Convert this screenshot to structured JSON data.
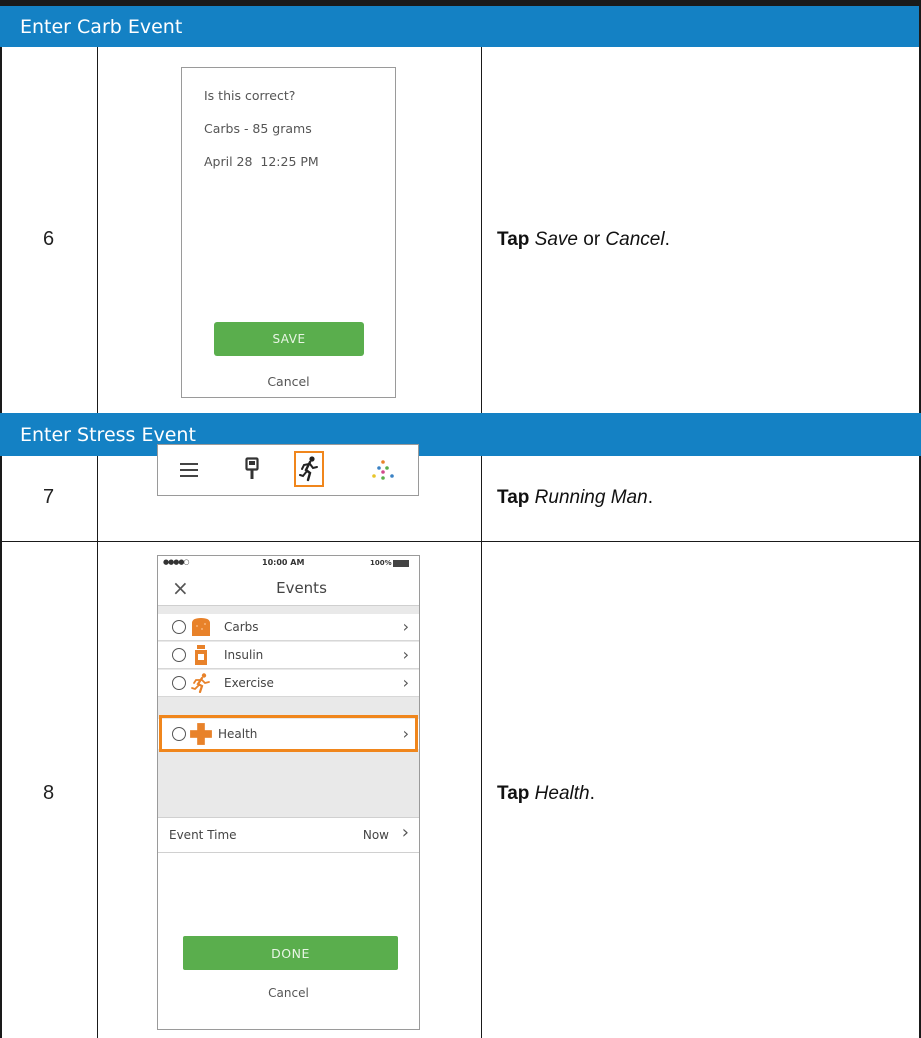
{
  "sections": {
    "carb_title": "Enter Carb Event",
    "stress_title": "Enter Stress Event"
  },
  "steps": [
    {
      "number": "6",
      "action": "Tap",
      "target": "Save",
      "connector": " or ",
      "target2": "Cancel",
      "end": "."
    },
    {
      "number": "7",
      "action": "Tap",
      "target": "Running Man",
      "end": "."
    },
    {
      "number": "8",
      "action": "Tap",
      "target": "Health",
      "end": "."
    }
  ],
  "confirm_screen": {
    "question": "Is this correct?",
    "carbs_line": "Carbs - 85 grams",
    "datetime": "April 28  12:25 PM",
    "save_label": "SAVE",
    "cancel_label": "Cancel"
  },
  "toolbar": {
    "icons": [
      "menu-icon",
      "glucose-meter-icon",
      "running-man-icon",
      "dots-icon"
    ],
    "highlighted": "running-man-icon",
    "highlight_color": "#f0861c"
  },
  "events_screen": {
    "status_signal": "●●●●○",
    "status_time": "10:00 AM",
    "status_battery": "100%",
    "close_glyph": "×",
    "title": "Events",
    "rows": [
      {
        "label": "Carbs",
        "icon": "carbs-icon"
      },
      {
        "label": "Insulin",
        "icon": "insulin-icon"
      },
      {
        "label": "Exercise",
        "icon": "exercise-icon"
      },
      {
        "label": "Health",
        "icon": "health-icon"
      }
    ],
    "highlighted_row": "Health",
    "event_time_label": "Event Time",
    "event_time_value": "Now",
    "done_label": "DONE",
    "cancel_label": "Cancel"
  },
  "colors": {
    "section_bar": "#1481c4",
    "button_green": "#5aae4d",
    "highlight_orange": "#f0861c",
    "icon_orange": "#e8822a"
  }
}
